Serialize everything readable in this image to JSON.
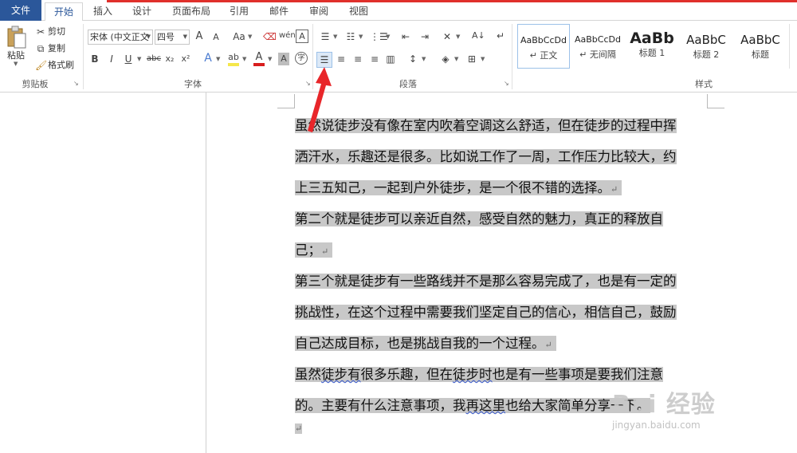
{
  "tabs": [
    {
      "label": "文件"
    },
    {
      "label": "开始"
    },
    {
      "label": "插入"
    },
    {
      "label": "设计"
    },
    {
      "label": "页面布局"
    },
    {
      "label": "引用"
    },
    {
      "label": "邮件"
    },
    {
      "label": "审阅"
    },
    {
      "label": "视图"
    }
  ],
  "clipboard": {
    "paste": "粘贴",
    "cut": "剪切",
    "copy": "复制",
    "format_painter": "格式刷",
    "label": "剪贴板"
  },
  "font": {
    "name": "宋体 (中文正文",
    "size": "四号",
    "grow": "A",
    "shrink": "A",
    "change_case": "Aa",
    "label": "字体",
    "bold": "B",
    "italic": "I",
    "underline": "U",
    "strike": "abc",
    "sub": "x₂",
    "sup": "x²"
  },
  "paragraph": {
    "label": "段落"
  },
  "styles": {
    "label": "样式",
    "items": [
      {
        "sample": "AaBbCcDd",
        "name": "↵ 正文"
      },
      {
        "sample": "AaBbCcDd",
        "name": "↵ 无间隔"
      },
      {
        "sample": "AaBb",
        "name": "标题 1"
      },
      {
        "sample": "AaBbC",
        "name": "标题 2"
      },
      {
        "sample": "AaBbC",
        "name": "标题"
      }
    ]
  },
  "document": {
    "lines": [
      {
        "text": "虽然说徒步没有像在室内吹着空调这么舒适，但在徒步的过程中挥"
      },
      {
        "text": "洒汗水，乐趣还是很多。比如说工作了一周，工作压力比较大，约"
      },
      {
        "text": "上三五知己，一起到户外徒步，是一个很不错的选择。"
      },
      {
        "text": "第二个就是徒步可以亲近自然，感受自然的魅力，真正的释放自"
      },
      {
        "text": "己；"
      },
      {
        "text": "第三个就是徒步有一些路线并不是那么容易完成了，也是有一定的"
      },
      {
        "text": "挑战性，在这个过程中需要我们坚定自己的信心，相信自己，鼓励"
      },
      {
        "text": "自己达成目标，也是挑战自我的一个过程。"
      },
      {
        "pre": "虽然",
        "s1": "徒步有",
        "mid": "很多乐趣，但在",
        "s2": "徒步时",
        "post": "也是有一些事项是要我们注意"
      },
      {
        "pre": "的。主要有什么注意事项，我",
        "s1": "再这里",
        "post": "也给大家简单分享一下。"
      }
    ],
    "para_mark": "↵"
  },
  "watermark": {
    "main": "Bai 经验",
    "sub": "jingyan.baidu.com"
  },
  "colors": {
    "file_tab": "#2b579a",
    "accent": "#e0302b",
    "highlight": "#c8c8c8",
    "font_color": "#d81e1e",
    "highlight_color": "#f5e74a"
  }
}
